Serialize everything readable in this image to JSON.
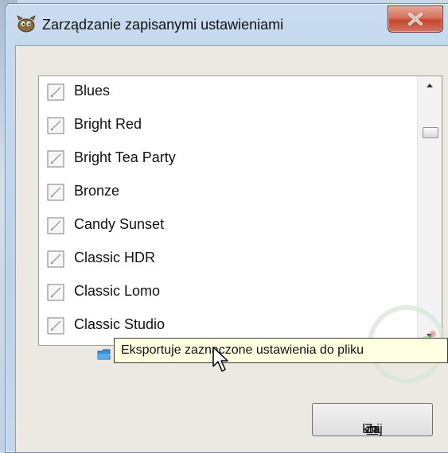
{
  "window": {
    "title": "Zarządzanie zapisanymi ustawieniami",
    "close_glyph": "X"
  },
  "presets": {
    "items": [
      {
        "label": "Blues",
        "icon": "preset-icon"
      },
      {
        "label": "Bright Red",
        "icon": "preset-icon"
      },
      {
        "label": "Bright Tea Party",
        "icon": "preset-icon"
      },
      {
        "label": "Bronze",
        "icon": "preset-icon"
      },
      {
        "label": "Candy Sunset",
        "icon": "preset-icon"
      },
      {
        "label": "Classic HDR",
        "icon": "preset-icon"
      },
      {
        "label": "Classic Lomo",
        "icon": "preset-icon"
      },
      {
        "label": "Classic Studio",
        "icon": "preset-icon"
      }
    ]
  },
  "toolbar": {
    "import_icon": "folder-icon",
    "export_icon": "export-arrow-icon",
    "delete_icon": "delete-x-icon"
  },
  "tooltip": {
    "text": "Eksportuje zaznaczone ustawienia do pliku"
  },
  "footer": {
    "close_pre": "Za",
    "close_mnemonic": "m",
    "close_post": "knij"
  },
  "colors": {
    "delete": "#d8261b",
    "tooltip_bg": "#ffffe1",
    "close_button": "#c4462e"
  }
}
